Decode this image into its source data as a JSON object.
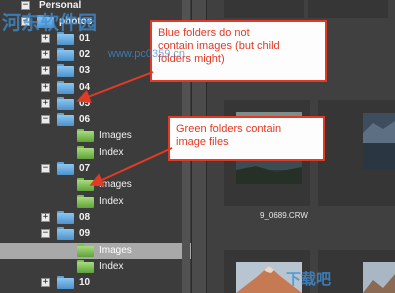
{
  "tree": {
    "items": [
      {
        "label": "Personal",
        "indent": 0,
        "toggle": "-",
        "folder": "",
        "selected": false
      },
      {
        "label": "photos",
        "indent": 0,
        "toggle": "-",
        "folder": "blue",
        "selected": false
      },
      {
        "label": "01",
        "indent": 1,
        "toggle": "+",
        "folder": "blue",
        "selected": false
      },
      {
        "label": "02",
        "indent": 1,
        "toggle": "+",
        "folder": "blue",
        "selected": false
      },
      {
        "label": "03",
        "indent": 1,
        "toggle": "+",
        "folder": "blue",
        "selected": false
      },
      {
        "label": "04",
        "indent": 1,
        "toggle": "+",
        "folder": "blue",
        "selected": false
      },
      {
        "label": "05",
        "indent": 1,
        "toggle": "+",
        "folder": "blue",
        "selected": false
      },
      {
        "label": "06",
        "indent": 1,
        "toggle": "-",
        "folder": "blue",
        "selected": false
      },
      {
        "label": "Images",
        "indent": 2,
        "toggle": "",
        "folder": "green",
        "selected": false
      },
      {
        "label": "Index",
        "indent": 2,
        "toggle": "",
        "folder": "green",
        "selected": false
      },
      {
        "label": "07",
        "indent": 1,
        "toggle": "-",
        "folder": "blue",
        "selected": false
      },
      {
        "label": "Images",
        "indent": 2,
        "toggle": "",
        "folder": "green",
        "selected": false
      },
      {
        "label": "Index",
        "indent": 2,
        "toggle": "",
        "folder": "green",
        "selected": false
      },
      {
        "label": "08",
        "indent": 1,
        "toggle": "+",
        "folder": "blue",
        "selected": false
      },
      {
        "label": "09",
        "indent": 1,
        "toggle": "-",
        "folder": "blue",
        "selected": false
      },
      {
        "label": "Images",
        "indent": 2,
        "toggle": "",
        "folder": "green",
        "selected": true
      },
      {
        "label": "Index",
        "indent": 2,
        "toggle": "",
        "folder": "green",
        "selected": false
      },
      {
        "label": "10",
        "indent": 1,
        "toggle": "+",
        "folder": "blue",
        "selected": false
      }
    ]
  },
  "thumbnails": {
    "caption": "9_0689.CRW"
  },
  "callouts": {
    "blue": {
      "lines": [
        "Blue folders do not",
        "contain images (but child",
        "folders might)"
      ]
    },
    "green": {
      "lines": [
        "Green folders contain",
        "image files"
      ]
    }
  },
  "watermark": {
    "site": "河东软件园",
    "url": "www.pc0359.cn",
    "corner": "下载吧"
  },
  "colors": {
    "annotation_red": "#e23a24",
    "blue_folder": "#5ea2d6",
    "green_folder": "#7fbf55",
    "selection": "#a9a9a9"
  }
}
